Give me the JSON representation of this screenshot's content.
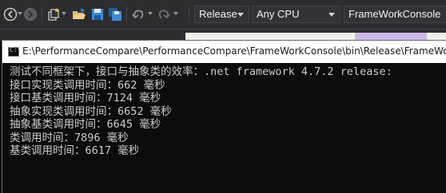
{
  "toolbar": {
    "configuration": "Release",
    "platform": "Any CPU",
    "startup_project": "FrameWorkConsole"
  },
  "console": {
    "title": "E:\\PerformanceCompare\\PerformanceCompare\\FrameWorkConsole\\bin\\Release\\FrameWorkC",
    "lines": [
      "测试不同框架下，接口与抽象类的效率：.net framework 4.7.2 release:",
      "接口实现类调用时间：662 毫秒",
      "接口基类调用时间：7124 毫秒",
      "抽象实现类调用时间：6652 毫秒",
      "抽象基类调用时间：6645 毫秒",
      "类调用时间：7896 毫秒",
      "基类调用时间：6617 毫秒"
    ]
  },
  "icons": {
    "back": "back-arrow-icon",
    "forward": "forward-arrow-icon",
    "new_project": "new-project-icon",
    "open_folder": "open-folder-icon",
    "save": "save-icon",
    "save_all": "save-all-icon",
    "undo": "undo-icon",
    "redo": "redo-icon",
    "console_app": "console-app-icon"
  },
  "colors": {
    "toolbar_bg": "#2d2d30",
    "console_bg": "#0c0c0c",
    "console_text": "#cccccc",
    "accent_folder": "#dcb67a",
    "accent_save": "#3c8bd6"
  }
}
